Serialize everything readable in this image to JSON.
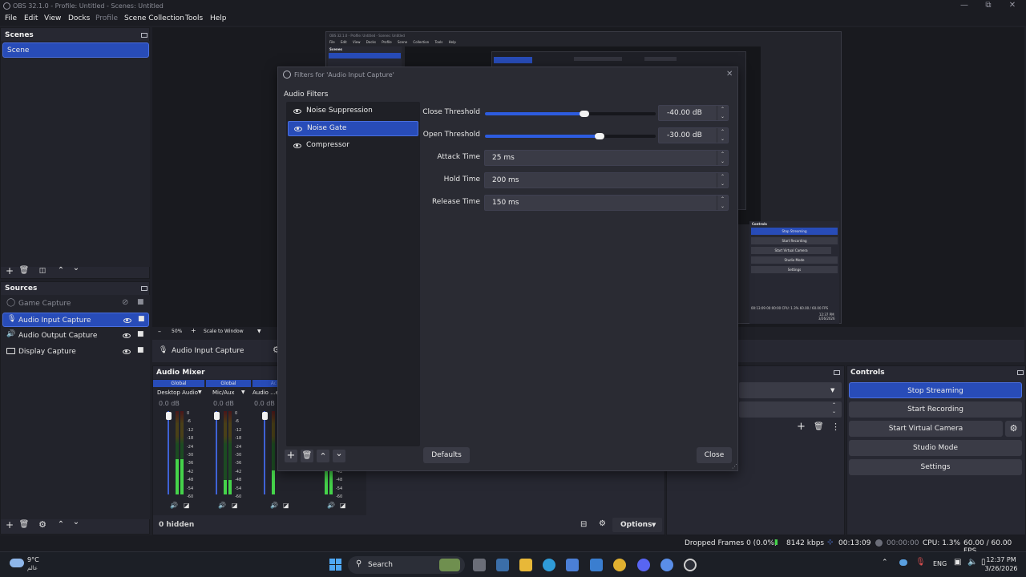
{
  "window": {
    "title": "OBS 32.1.0 - Profile: Untitled - Scenes: Untitled"
  },
  "menu": [
    "File",
    "Edit",
    "View",
    "Docks",
    "Profile",
    "Scene Collection",
    "Tools",
    "Help"
  ],
  "scenes": {
    "title": "Scenes",
    "items": [
      "Scene"
    ]
  },
  "sources": {
    "title": "Sources",
    "items": [
      "Game Capture",
      "Audio Input Capture",
      "Audio Output Capture",
      "Display Capture"
    ],
    "hidden_label": "0 hidden"
  },
  "preview_toolbar": {
    "zoom": "50%",
    "scale": "Scale to Window"
  },
  "context_bar": {
    "source": "Audio Input Capture"
  },
  "dialog": {
    "title": "Filters for 'Audio Input Capture'",
    "section": "Audio Filters",
    "filters": [
      "Noise Suppression",
      "Noise Gate",
      "Compressor"
    ],
    "selected_filter": "Noise Gate",
    "props": {
      "close_threshold_label": "Close Threshold",
      "close_threshold_value": "-40.00 dB",
      "close_threshold_level": 0.58,
      "open_threshold_label": "Open Threshold",
      "open_threshold_value": "-30.00 dB",
      "open_threshold_level": 0.67,
      "attack_label": "Attack Time",
      "attack_value": "25 ms",
      "hold_label": "Hold Time",
      "hold_value": "200 ms",
      "release_label": "Release Time",
      "release_value": "150 ms"
    },
    "defaults_btn": "Defaults",
    "close_btn": "Close"
  },
  "mixer": {
    "title": "Audio Mixer",
    "channels": [
      {
        "scope": "Global",
        "name": "Desktop Audio",
        "db": "0.0 dB",
        "volume": 1.0
      },
      {
        "scope": "Global",
        "name": "Mic/Aux",
        "db": "0.0 dB",
        "volume": 1.0
      },
      {
        "scope": "Ac",
        "name": "Audio ...e",
        "db": "0.0 dB",
        "volume": 1.0
      }
    ],
    "ticks": [
      "0",
      "-6",
      "-12",
      "-18",
      "-24",
      "-30",
      "-36",
      "-42",
      "-48",
      "-54",
      "-60"
    ],
    "options_label": "Options"
  },
  "controls": {
    "title": "Controls",
    "buttons": [
      "Stop Streaming",
      "Start Recording",
      "Start Virtual Camera",
      "Studio Mode",
      "Settings"
    ]
  },
  "status": {
    "dropped": "Dropped Frames 0 (0.0%)",
    "bitrate": "8142 kbps",
    "stream_time": "00:13:09",
    "rec_time": "00:00:00",
    "cpu": "CPU: 1.3%",
    "fps": "60.00 / 60.00 FPS"
  },
  "taskbar": {
    "weather_temp": "9°C",
    "weather_loc": "عالم",
    "search": "Search",
    "lang": "ENG",
    "time": "12:37 PM",
    "date": "3/26/2026"
  },
  "mini_preview": {
    "title": "OBS 32.1.0 - Profile: Untitled - Scenes: Untitled",
    "menu": [
      "File",
      "Edit",
      "View",
      "Docks",
      "Profile",
      "Scene Collection",
      "Tools",
      "Help"
    ],
    "scenes_title": "Scenes",
    "controls_title": "Controls",
    "buttons": [
      "Stop Streaming",
      "Start Recording",
      "Start Virtual Camera",
      "Studio Mode",
      "Settings"
    ],
    "stream_time": "00:13:09",
    "rec_time": "00:00:00",
    "cpu": "CPU: 1.3%",
    "fps": "60.00 / 60.00 FPS",
    "time": "12:37 PM",
    "date": "3/26/2026"
  },
  "colors": {
    "accent": "#284cb8",
    "dock_bg": "#272832",
    "dialog_bg": "#2a2b33"
  }
}
